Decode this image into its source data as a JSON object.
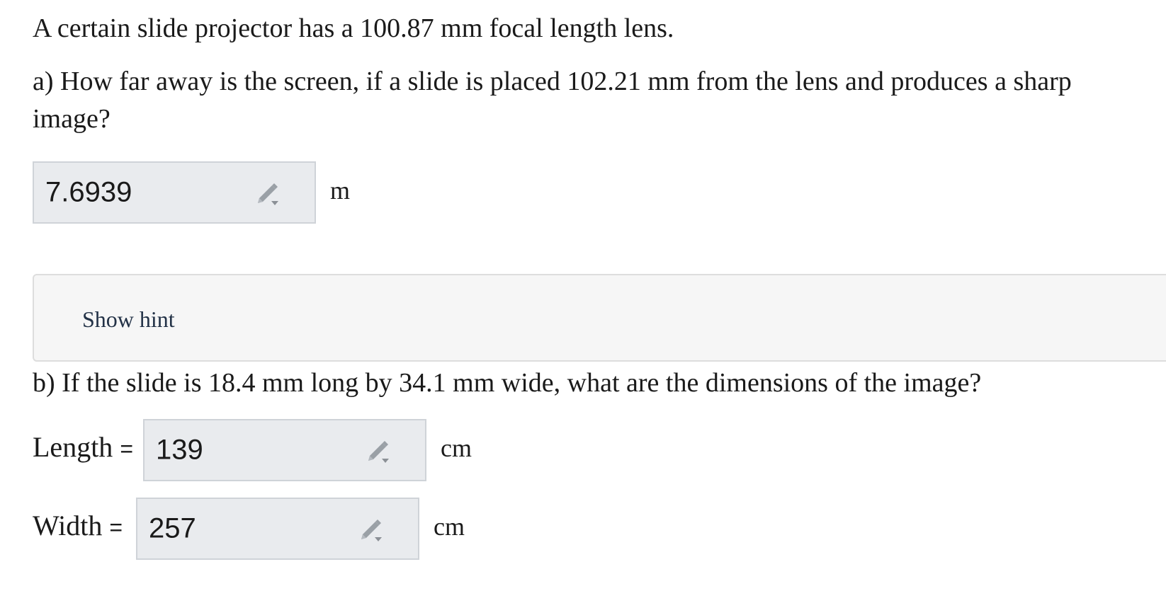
{
  "problem": {
    "intro": "A certain slide projector has a 100.87 mm focal length lens.",
    "part_a_line1": "a) How far away is the screen, if a slide is placed 102.21 mm from the lens and produces a sharp",
    "part_a_line2": "image?",
    "part_b": "b) If the slide is 18.4 mm long by 34.1 mm wide, what are the dimensions of the image?"
  },
  "answer_a": {
    "value": "7.6939",
    "unit": "m"
  },
  "hint": {
    "label": "Show hint"
  },
  "answer_b": {
    "length_label": "Length",
    "length_value": "139",
    "length_unit": "cm",
    "width_label": "Width",
    "width_value": "257",
    "width_unit": "cm",
    "equals": "="
  },
  "icons": {
    "edit": "pencil-dropdown-icon"
  }
}
